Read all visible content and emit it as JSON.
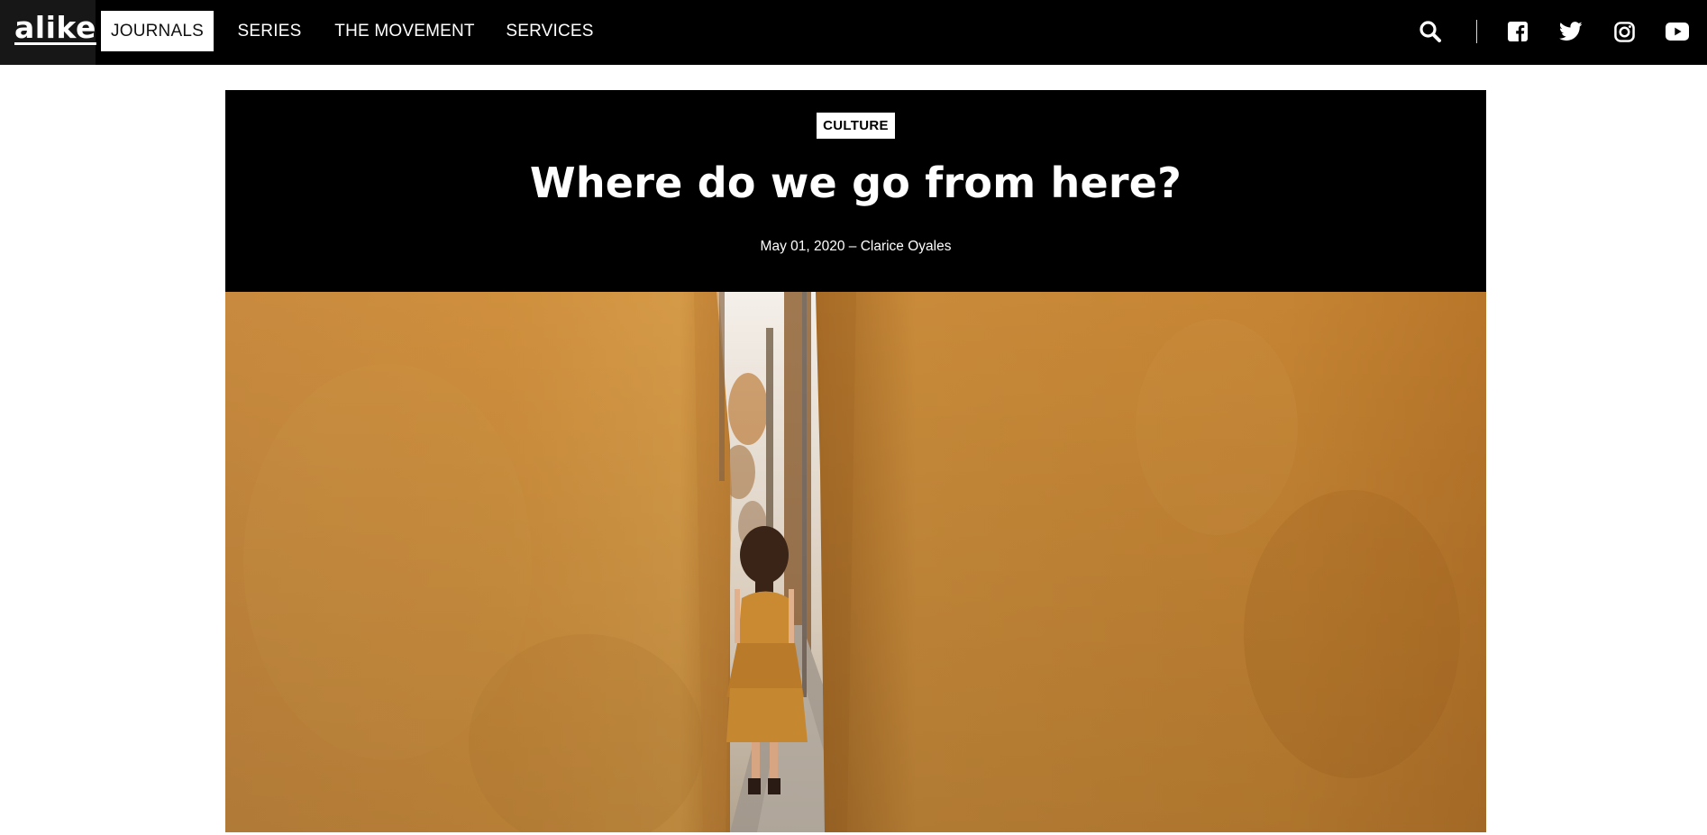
{
  "brand": {
    "logo_text": "alike"
  },
  "nav": {
    "items": [
      {
        "label": "JOURNALS",
        "active": true
      },
      {
        "label": "SERIES",
        "active": false
      },
      {
        "label": "THE MOVEMENT",
        "active": false
      },
      {
        "label": "SERVICES",
        "active": false
      }
    ]
  },
  "header_icons": [
    "search-icon",
    "facebook-icon",
    "twitter-icon",
    "instagram-icon",
    "youtube-icon"
  ],
  "article": {
    "category": "CULTURE",
    "title": "Where do we go from here?",
    "byline": "May 01, 2020 – Clarice Oyales"
  },
  "colors": {
    "nav_background": "#000000",
    "logo_cell": "#171717",
    "hero_wall": "#c88a38",
    "text_light": "#ffffff"
  }
}
